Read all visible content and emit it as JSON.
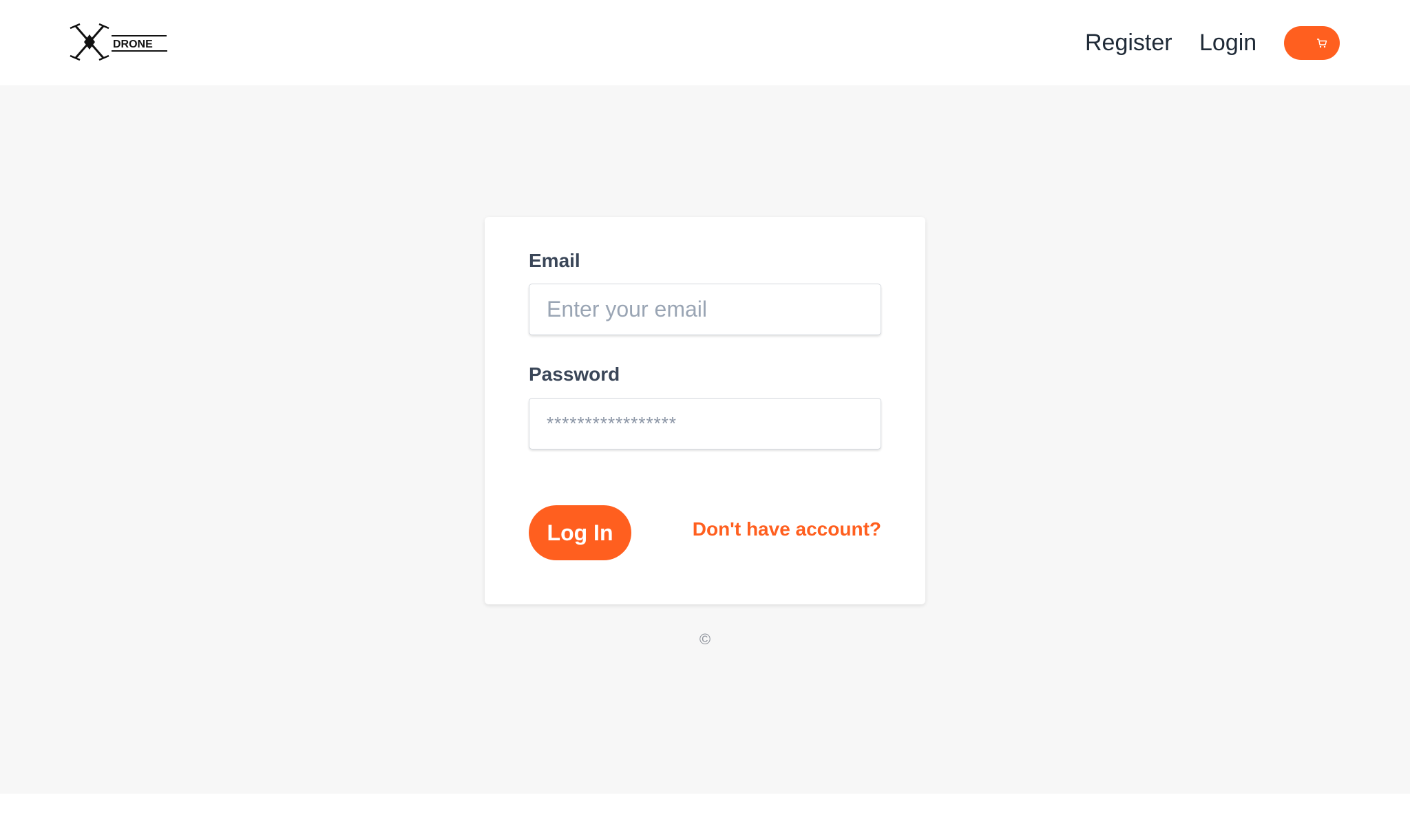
{
  "brand": {
    "logo_text": "DRONE",
    "logo_icon": "drone-quadcopter-icon"
  },
  "nav": {
    "register_label": "Register",
    "login_label": "Login",
    "cart_icon": "cart-icon"
  },
  "form": {
    "email_label": "Email",
    "email_placeholder": "Enter your email",
    "email_value": "",
    "password_label": "Password",
    "password_placeholder": "*****************",
    "password_value": "",
    "submit_label": "Log In",
    "register_link": "Don't have account?"
  },
  "footer": {
    "copyright": "©"
  },
  "colors": {
    "accent": "#ff5f1f",
    "page_background": "#f7f7f7",
    "card_background": "#ffffff",
    "label_text": "#3a4658",
    "nav_text": "#1f2a37"
  }
}
